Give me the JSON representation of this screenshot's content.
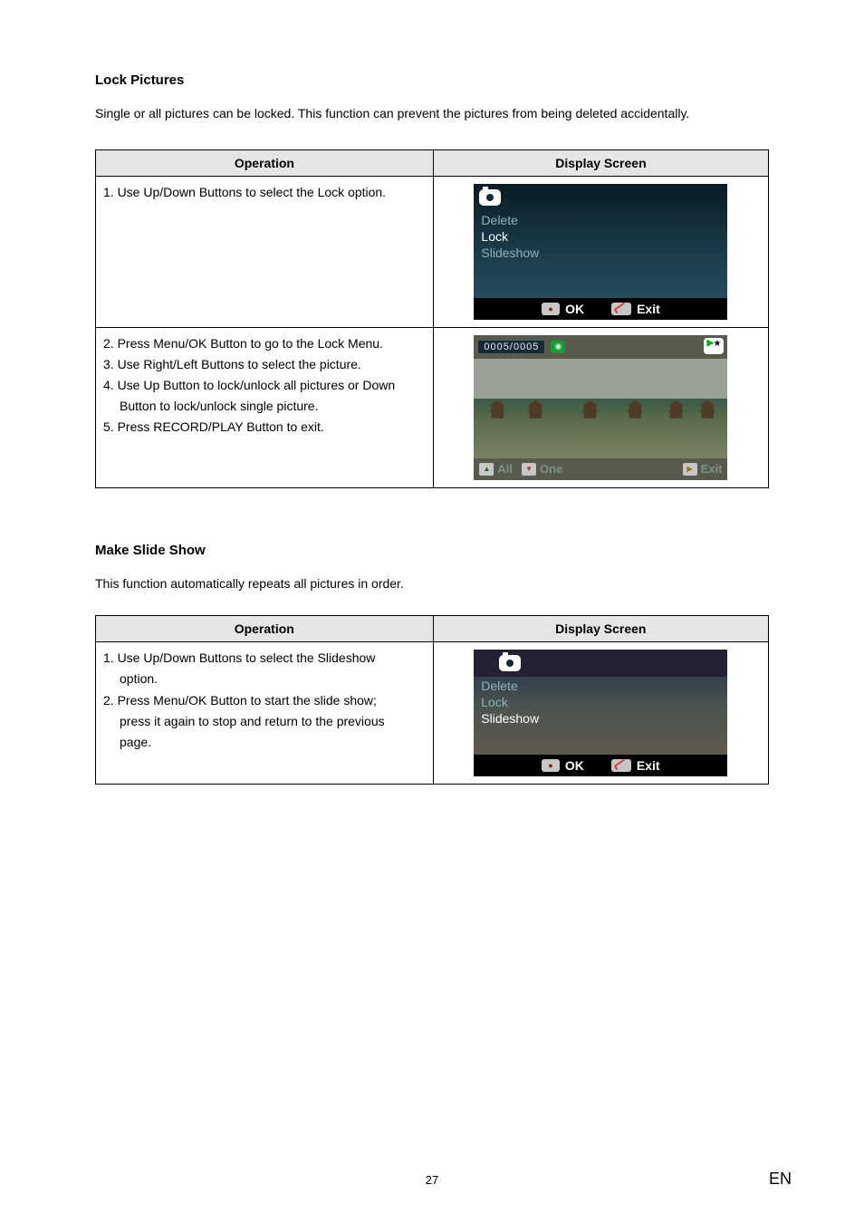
{
  "section1": {
    "title": "Lock Pictures",
    "para": "Single or all pictures can be locked. This function can prevent the pictures from being deleted accidentally."
  },
  "table_headers": {
    "operation": "Operation",
    "display": "Display Screen"
  },
  "t1": {
    "r1": "1. Use Up/Down Buttons to select the Lock option.",
    "r2a": "2. Press Menu/OK Button to go to the Lock Menu.",
    "r2b": "3. Use Right/Left Buttons to select the picture.",
    "r2c": "4. Use Up Button to lock/unlock all pictures or Down",
    "r2c_sub": "Button to lock/unlock single picture.",
    "r2d": "5. Press RECORD/PLAY Button to exit."
  },
  "menu": {
    "delete": "Delete",
    "lock": "Lock",
    "slideshow": "Slideshow",
    "ok": "OK",
    "exit": "Exit"
  },
  "browse": {
    "counter": "0005/0005",
    "all": "All",
    "one": "One",
    "exit": "Exit"
  },
  "section2": {
    "title": "Make Slide Show",
    "para": "This function automatically repeats all pictures in order."
  },
  "t2": {
    "r1a": "1. Use Up/Down Buttons to select the Slideshow",
    "r1a_sub": "option.",
    "r1b": "2. Press Menu/OK Button to start the slide show;",
    "r1b_sub": "press it again to stop and return to the previous",
    "r1b_sub2": "page."
  },
  "footer": {
    "page": "27",
    "lang": "EN"
  }
}
